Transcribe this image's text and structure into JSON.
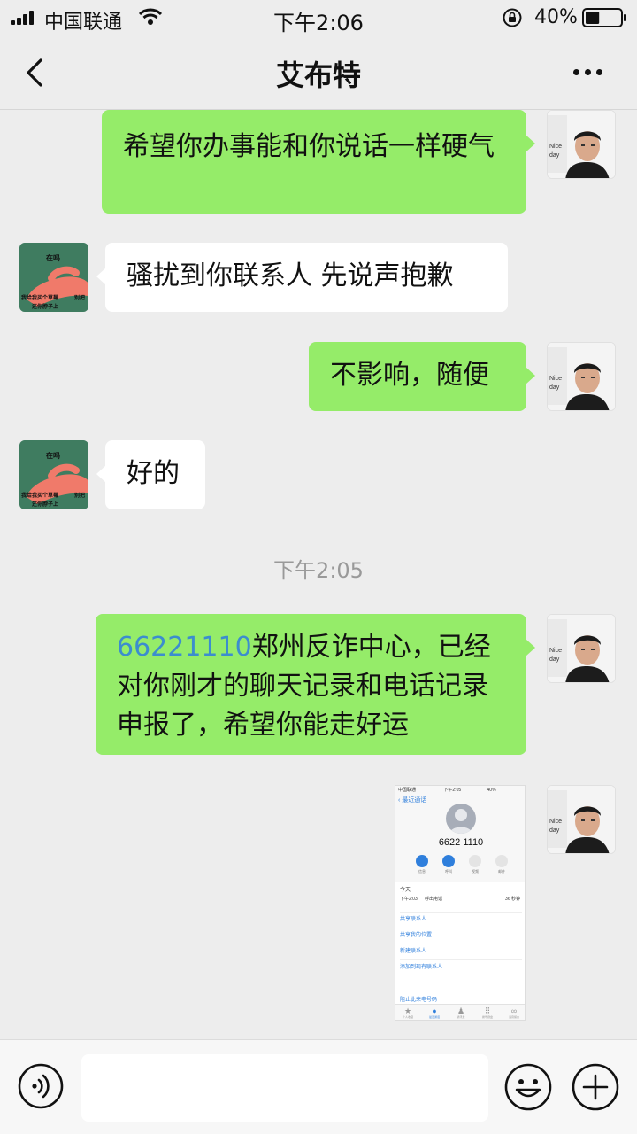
{
  "status_bar": {
    "carrier": "中国联通",
    "time": "下午2:06",
    "battery_percent": "40%",
    "battery_level": 0.4
  },
  "header": {
    "title": "艾布特",
    "back_icon": "chevron-left-icon",
    "more_icon": "more-dots-icon"
  },
  "messages": [
    {
      "direction": "outgoing",
      "text": "希望你办事能和你说话一样硬气"
    },
    {
      "direction": "incoming",
      "text": "骚扰到你联系人 先说声抱歉"
    },
    {
      "direction": "outgoing",
      "text": "不影响，随便"
    },
    {
      "direction": "incoming",
      "text": "好的"
    },
    {
      "type": "timestamp",
      "text": "下午2:05"
    },
    {
      "direction": "outgoing",
      "link_text": "66221110",
      "text": "郑州反诈中心，已经对你刚才的聊天记录和电话记录申报了，希望你能走好运"
    },
    {
      "direction": "outgoing",
      "type": "image"
    }
  ],
  "sticker_avatar": {
    "top_text": "在吗",
    "bottom_text": "我给我买个草莓",
    "bottom_text2": "还你脖子上",
    "side_text": "别把"
  },
  "shared_screenshot": {
    "status_carrier": "中国联通",
    "status_time": "下午2:05",
    "status_battery": "40%",
    "back_label": "最近通话",
    "number": "6622 1110",
    "actions": [
      "信息",
      "呼叫",
      "视频",
      "邮件"
    ],
    "today_label": "今天",
    "call_time": "下午2:03",
    "call_type": "呼出电话",
    "call_duration": "36 秒钟",
    "links": [
      "共享联系人",
      "共享我的位置",
      "新建联系人",
      "添加到现有联系人"
    ],
    "block_label": "阻止此来电号码",
    "tabs": [
      "个人收藏",
      "最近通话",
      "通讯录",
      "拨号键盘",
      "语音留言"
    ]
  },
  "input_bar": {
    "placeholder": "",
    "voice_icon": "voice-icon",
    "emoji_icon": "emoji-icon",
    "plus_icon": "plus-icon"
  },
  "colors": {
    "background": "#ededed",
    "outgoing_bubble": "#95ec69",
    "incoming_bubble": "#ffffff",
    "link": "#3c8dce"
  }
}
